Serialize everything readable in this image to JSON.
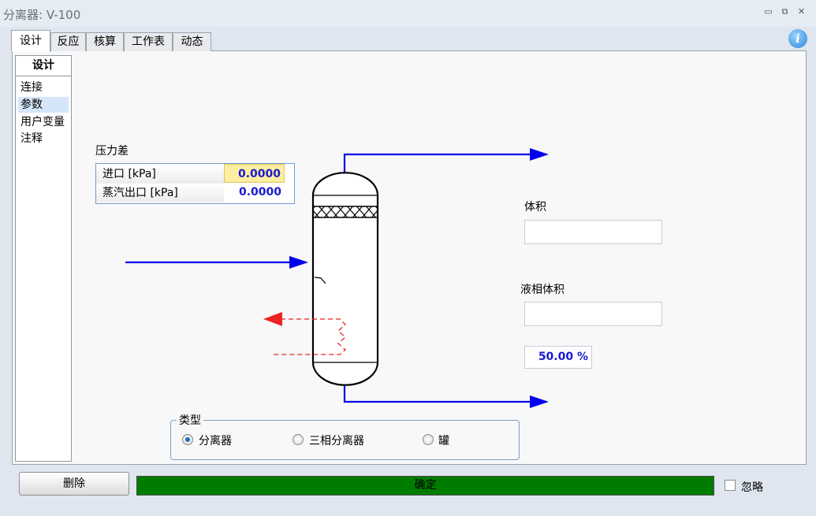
{
  "window": {
    "title": "分离器: V-100",
    "controls": [
      "▭",
      "⧉",
      "✕"
    ]
  },
  "tabs": [
    "设计",
    "反应",
    "核算",
    "工作表",
    "动态"
  ],
  "sidebar": {
    "header": "设计",
    "items": [
      "连接",
      "参数",
      "用户变量",
      "注释"
    ],
    "selected": "参数"
  },
  "pressure_drop": {
    "title": "压力差",
    "rows": [
      {
        "label": "进口 [kPa]",
        "value": "0.0000"
      },
      {
        "label": "蒸汽出口 [kPa]",
        "value": "0.0000"
      }
    ]
  },
  "volume": {
    "label": "体积",
    "value": ""
  },
  "liquid_volume": {
    "label": "液相体积",
    "value": "",
    "percent": "50.00 %"
  },
  "type": {
    "title": "类型",
    "options": [
      "分离器",
      "三相分离器",
      "罐"
    ],
    "selected": "分离器"
  },
  "footer": {
    "delete_label": "删除",
    "ok_label": "确定",
    "ignore_label": "忽略",
    "ignore_checked": false
  },
  "colors": {
    "stream": "#0000ee",
    "energy": "#ee2222",
    "ok_bar": "#007d00",
    "value_text": "#1a1ad0"
  }
}
